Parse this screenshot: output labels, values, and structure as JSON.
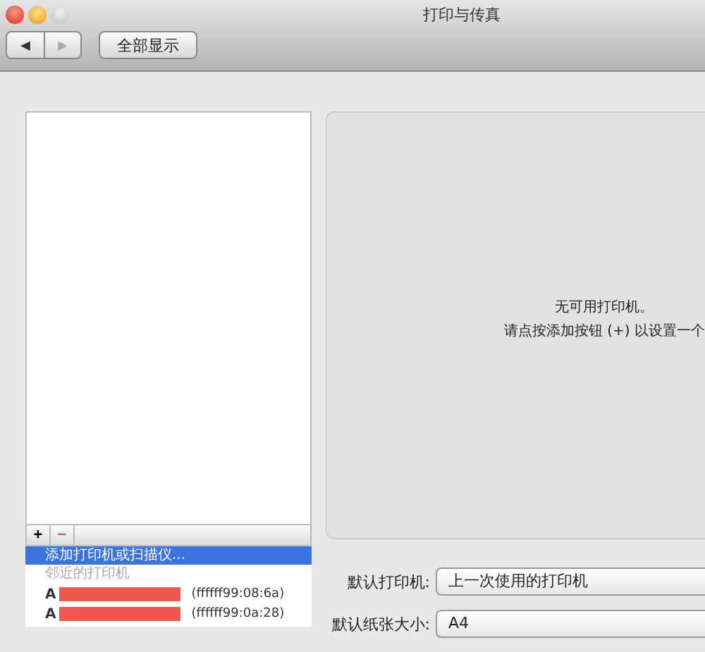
{
  "window": {
    "title": "打印与传真"
  },
  "toolbar": {
    "back": "◀",
    "forward": "▶",
    "show_all": "全部显示"
  },
  "printer_list": {
    "add": "+",
    "remove": "−"
  },
  "menu": [
    {
      "kind": "action",
      "label": "添加打印机或扫描仪...",
      "selected": true
    },
    {
      "kind": "header",
      "label": "邻近的打印机",
      "selected": false
    },
    {
      "kind": "printer",
      "label": "A",
      "address": "(ffffff99:08:6a)",
      "selected": false
    },
    {
      "kind": "printer",
      "label": "A",
      "address": "(ffffff99:0a:28)",
      "selected": false
    }
  ],
  "detail": {
    "lines": [
      "无可用打印机。",
      "请点按添加按钮 (+) 以设置一个"
    ]
  },
  "settings": [
    {
      "label": "默认打印机:",
      "value": "上一次使用的打印机"
    },
    {
      "label": "默认纸张大小:",
      "value": "A4"
    }
  ]
}
